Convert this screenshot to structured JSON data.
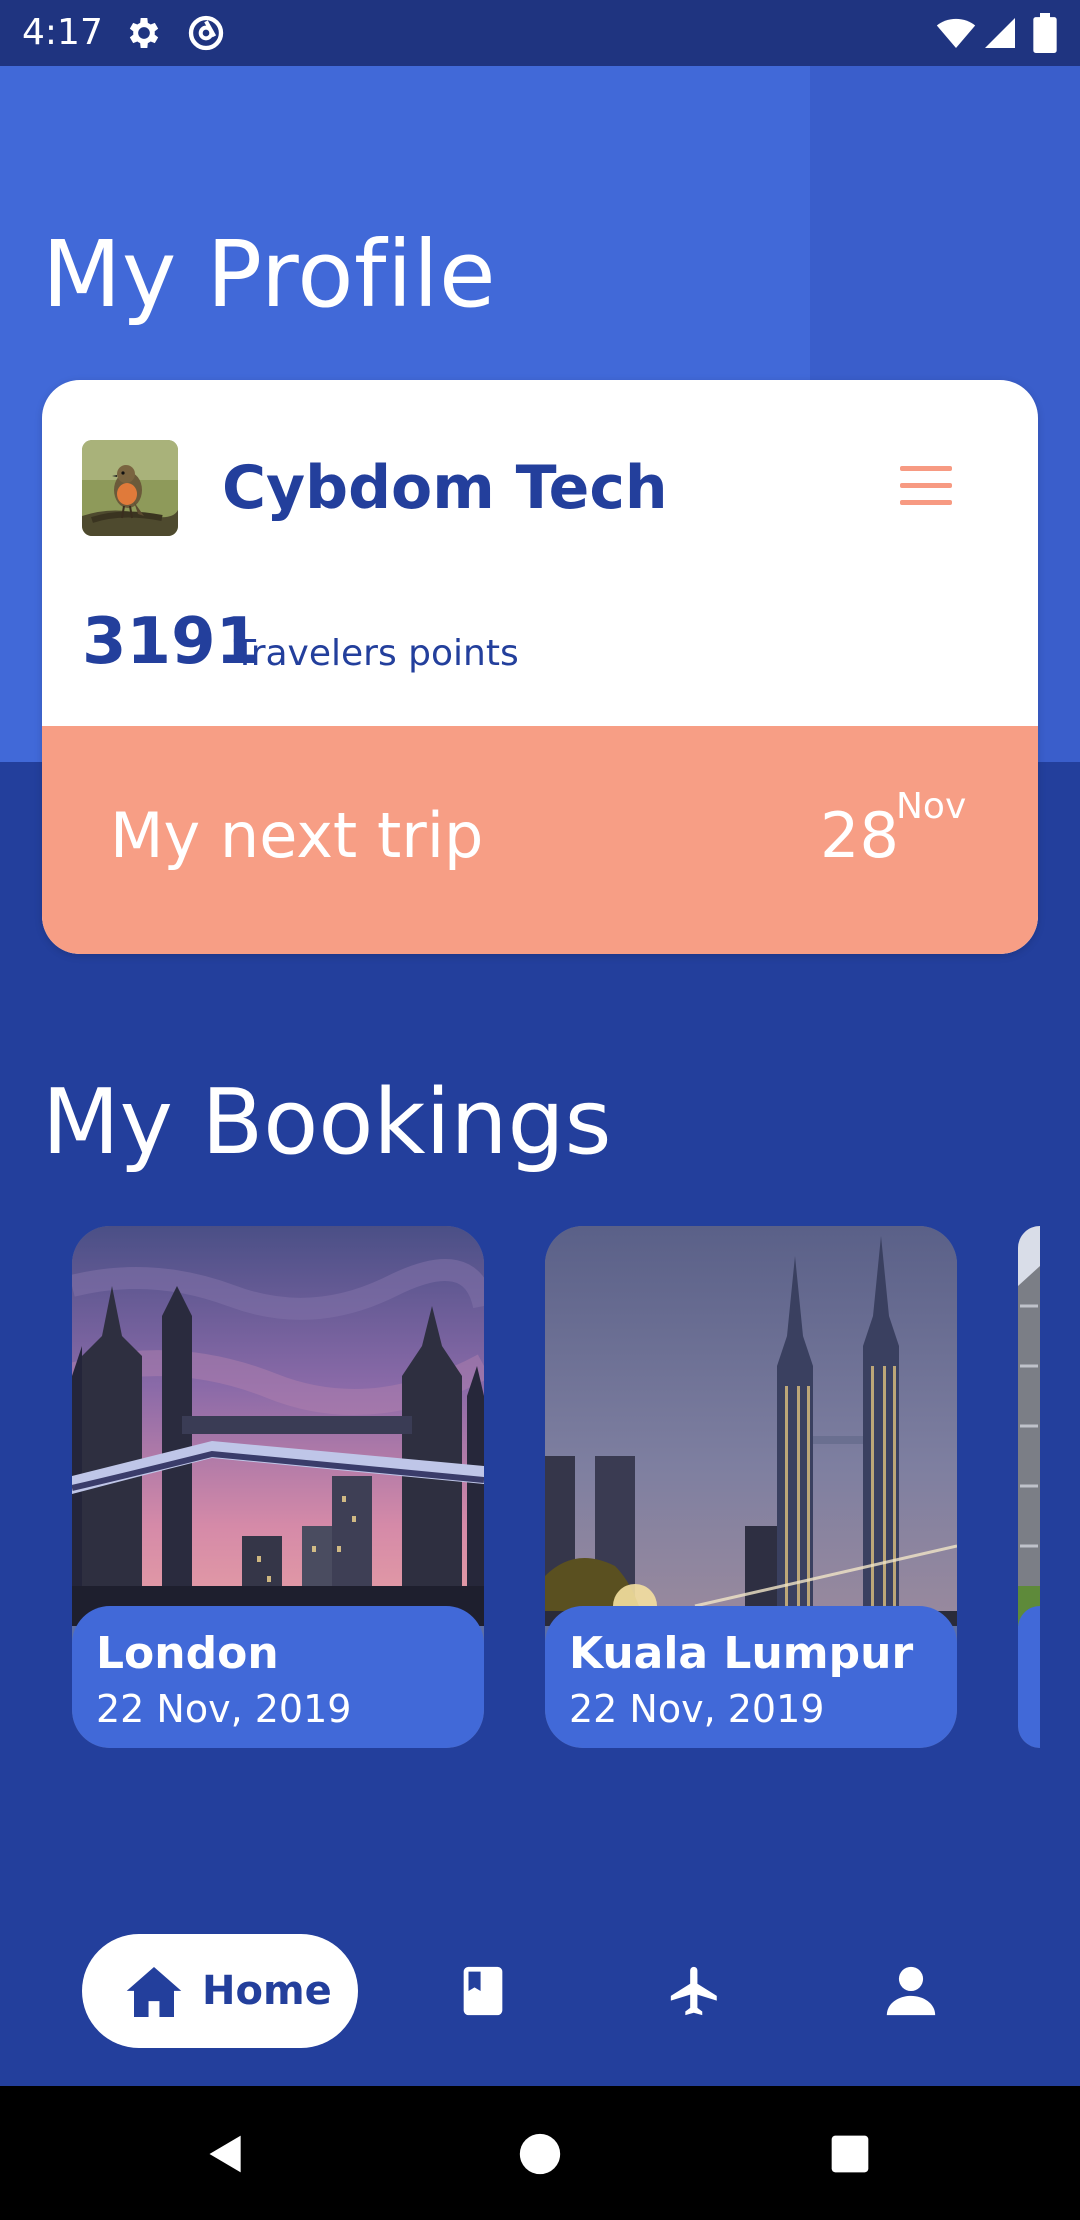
{
  "status_bar": {
    "time": "4:17",
    "icons": [
      "gear-icon",
      "at-sign-icon",
      "wifi-icon",
      "signal-icon",
      "battery-icon"
    ]
  },
  "profile": {
    "title": "My Profile",
    "name": "Cybdom Tech",
    "avatar": "robin-bird-photo",
    "points_value": "3191",
    "points_label": "Travelers points",
    "menu_icon": "hamburger-icon"
  },
  "next_trip": {
    "label": "My next trip",
    "day": "28",
    "month": "Nov"
  },
  "bookings": {
    "title": "My Bookings",
    "items": [
      {
        "city": "London",
        "date": "22 Nov, 2019",
        "image": "tower-bridge-photo"
      },
      {
        "city": "Kuala Lumpur",
        "date": "22 Nov, 2019",
        "image": "petronas-towers-photo"
      },
      {
        "city": "",
        "date": "",
        "image": "eiffel-tower-photo"
      }
    ]
  },
  "bottom_nav": {
    "items": [
      {
        "label": "Home",
        "icon": "home-icon",
        "active": true
      },
      {
        "label": "",
        "icon": "book-icon",
        "active": false
      },
      {
        "label": "",
        "icon": "airplane-icon",
        "active": false
      },
      {
        "label": "",
        "icon": "person-icon",
        "active": false
      }
    ]
  },
  "colors": {
    "primary_dark": "#233F9C",
    "primary": "#4169D8",
    "accent": "#F79E85",
    "white": "#FFFFFF"
  }
}
